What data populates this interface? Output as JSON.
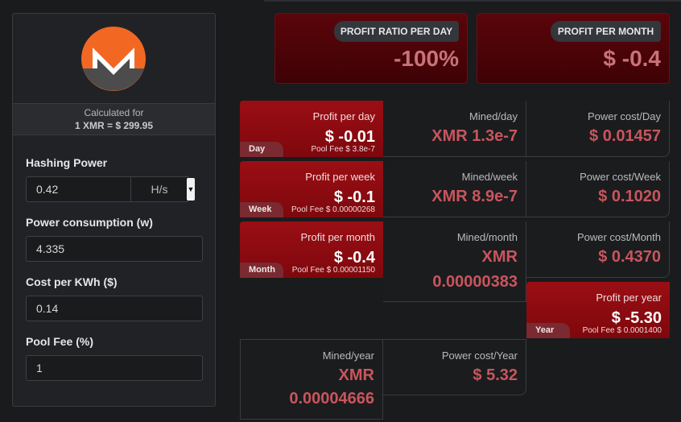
{
  "brand": {
    "logo_icon": "monero-logo-icon",
    "orange": "#f26822",
    "dark": "#4c4c4c"
  },
  "rate": {
    "label": "Calculated for",
    "value": "1 XMR = $ 299.95"
  },
  "fields": {
    "hashing_power": {
      "label": "Hashing Power",
      "value": "0.42",
      "unit": "H/s"
    },
    "power_consumption": {
      "label": "Power consumption (w)",
      "value": "4.335"
    },
    "cost_per_kwh": {
      "label": "Cost per KWh ($)",
      "value": "0.14"
    },
    "pool_fee": {
      "label": "Pool Fee (%)",
      "value": "1"
    }
  },
  "summary": {
    "ratio": {
      "label": "PROFIT RATIO PER DAY",
      "value": "-100%"
    },
    "month": {
      "label": "PROFIT PER MONTH",
      "value": "$ -0.4"
    }
  },
  "day": {
    "tag": "Day",
    "profit_label": "Profit per day",
    "profit": "$ -0.01",
    "fee": "Pool Fee $ 3.8e-7",
    "mined_label": "Mined/day",
    "mined": "XMR 1.3e-7",
    "cost_label": "Power cost/Day",
    "cost": "$ 0.01457"
  },
  "week": {
    "tag": "Week",
    "profit_label": "Profit per week",
    "profit": "$ -0.1",
    "fee": "Pool Fee $ 0.00000268",
    "mined_label": "Mined/week",
    "mined": "XMR 8.9e-7",
    "cost_label": "Power cost/Week",
    "cost": "$ 0.1020"
  },
  "month": {
    "tag": "Month",
    "profit_label": "Profit per month",
    "profit": "$ -0.4",
    "fee": "Pool Fee $ 0.00001150",
    "mined_label": "Mined/month",
    "mined_unit": "XMR",
    "mined": "0.00000383",
    "cost_label": "Power cost/Month",
    "cost": "$ 0.4370"
  },
  "year": {
    "tag": "Year",
    "profit_label": "Profit per year",
    "profit": "$ -5.30",
    "fee": "Pool Fee $ 0.0001400",
    "mined_label": "Mined/year",
    "mined_unit": "XMR",
    "mined": "0.00004666",
    "cost_label": "Power cost/Year",
    "cost": "$ 5.32"
  }
}
